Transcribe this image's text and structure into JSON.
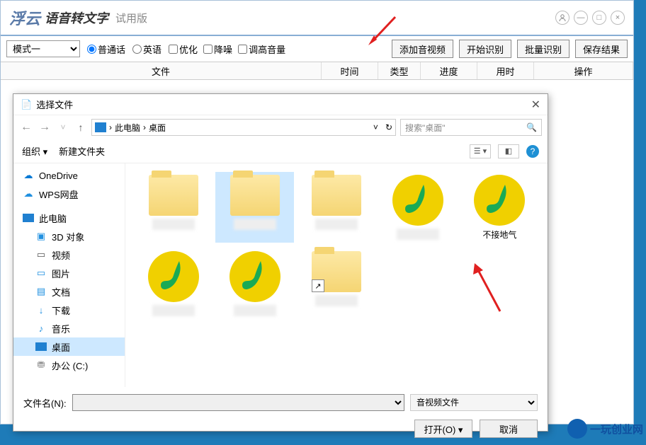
{
  "app": {
    "logo": "浮云",
    "title": "语音转文字",
    "trial": "试用版"
  },
  "toolbar": {
    "mode": "模式一",
    "radio_putonghua": "普通话",
    "radio_english": "英语",
    "cb_optimize": "优化",
    "cb_denoise": "降噪",
    "cb_volume": "调高音量",
    "btn_add": "添加音视频",
    "btn_start": "开始识别",
    "btn_batch": "批量识别",
    "btn_save": "保存结果"
  },
  "columns": {
    "file": "文件",
    "time": "时间",
    "type": "类型",
    "progress": "进度",
    "duration": "用时",
    "operate": "操作"
  },
  "dialog": {
    "title": "选择文件",
    "breadcrumb_pc": "此电脑",
    "breadcrumb_desktop": "桌面",
    "search_placeholder": "搜索\"桌面\"",
    "organize": "组织",
    "new_folder": "新建文件夹",
    "filename_label": "文件名(N):",
    "filetype": "音视频文件",
    "btn_open": "打开(O)",
    "btn_cancel": "取消"
  },
  "sidebar": {
    "onedrive": "OneDrive",
    "wps": "WPS网盘",
    "thispc": "此电脑",
    "objects3d": "3D 对象",
    "video": "视频",
    "pictures": "图片",
    "documents": "文档",
    "downloads": "下载",
    "music": "音乐",
    "desktop": "桌面",
    "drive_c": "办公 (C:)"
  },
  "files": {
    "item5_label": "不接地气"
  },
  "watermark": "一玩创业网"
}
